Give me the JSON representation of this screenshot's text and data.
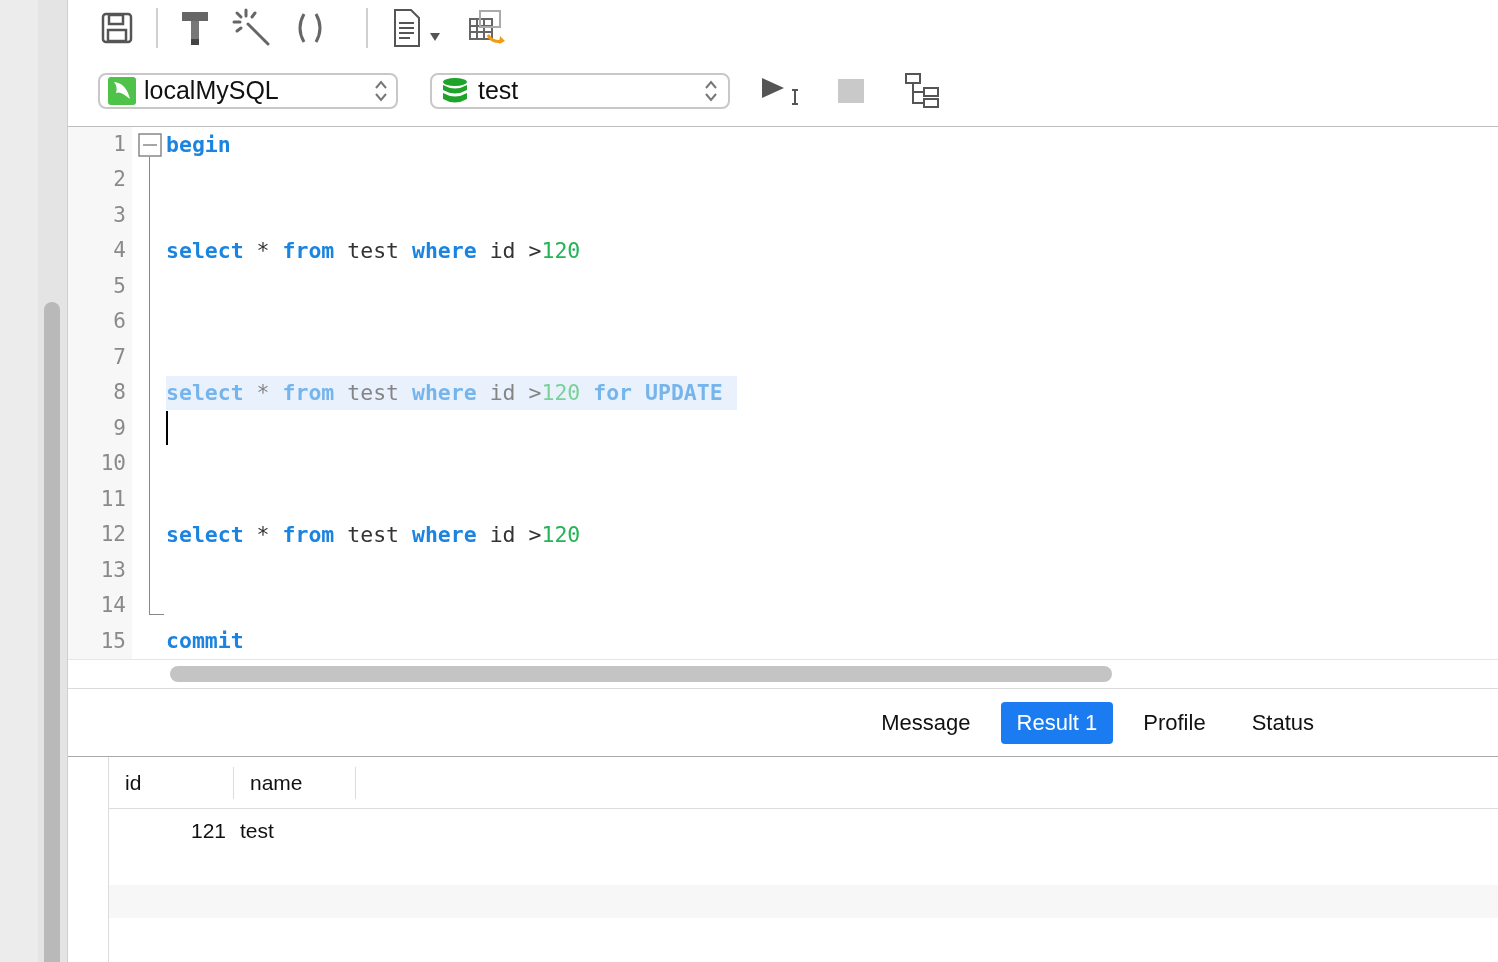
{
  "toolbar": {
    "connection": {
      "value": "localMySQL"
    },
    "database": {
      "value": "test"
    },
    "stop_disabled": true
  },
  "editor": {
    "fold_expanded": true,
    "lines": [
      {
        "number": "1",
        "selected": false,
        "tokens": [
          {
            "kind": "keyword",
            "text": "begin"
          }
        ]
      },
      {
        "number": "2",
        "selected": false
      },
      {
        "number": "3",
        "selected": false
      },
      {
        "number": "4",
        "selected": false,
        "tokens": [
          {
            "kind": "keyword",
            "text": "select"
          },
          {
            "kind": "plain",
            "text": " * "
          },
          {
            "kind": "keyword",
            "text": "from"
          },
          {
            "kind": "plain",
            "text": " test "
          },
          {
            "kind": "keyword",
            "text": "where"
          },
          {
            "kind": "plain",
            "text": " id >"
          },
          {
            "kind": "number",
            "text": "120"
          }
        ]
      },
      {
        "number": "5",
        "selected": false
      },
      {
        "number": "6",
        "selected": false
      },
      {
        "number": "7",
        "selected": false
      },
      {
        "number": "8",
        "selected": true,
        "tokens": [
          {
            "kind": "keyword",
            "text": "select"
          },
          {
            "kind": "plain",
            "text": " * "
          },
          {
            "kind": "keyword",
            "text": "from"
          },
          {
            "kind": "plain",
            "text": " test "
          },
          {
            "kind": "keyword",
            "text": "where"
          },
          {
            "kind": "plain",
            "text": " id >"
          },
          {
            "kind": "number",
            "text": "120 "
          },
          {
            "kind": "keyword",
            "text": "for UPDATE"
          }
        ]
      },
      {
        "number": "9",
        "selected": false,
        "caret": true
      },
      {
        "number": "10",
        "selected": false
      },
      {
        "number": "11",
        "selected": false
      },
      {
        "number": "12",
        "selected": false,
        "tokens": [
          {
            "kind": "keyword",
            "text": "select"
          },
          {
            "kind": "plain",
            "text": " * "
          },
          {
            "kind": "keyword",
            "text": "from"
          },
          {
            "kind": "plain",
            "text": " test "
          },
          {
            "kind": "keyword",
            "text": "where"
          },
          {
            "kind": "plain",
            "text": " id >"
          },
          {
            "kind": "number",
            "text": "120"
          }
        ]
      },
      {
        "number": "13",
        "selected": false
      },
      {
        "number": "14",
        "selected": false
      },
      {
        "number": "15",
        "selected": false,
        "tokens": [
          {
            "kind": "keyword",
            "text": "commit"
          }
        ]
      }
    ]
  },
  "result_tabs": [
    {
      "label": "Message",
      "selected": false
    },
    {
      "label": "Result 1",
      "selected": true
    },
    {
      "label": "Profile",
      "selected": false
    },
    {
      "label": "Status",
      "selected": false
    }
  ],
  "table": {
    "columns": [
      "id",
      "name"
    ],
    "rows": [
      {
        "cells": [
          "121",
          "test"
        ]
      }
    ]
  }
}
